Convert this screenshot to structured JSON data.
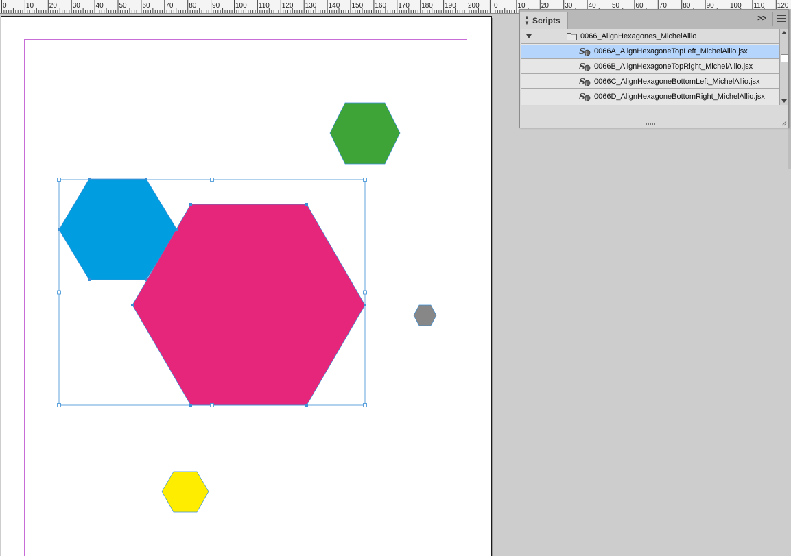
{
  "ruler": {
    "labels_left": [
      "0",
      "10",
      "20",
      "30",
      "40",
      "50",
      "60",
      "70",
      "80",
      "90",
      "100",
      "110",
      "120",
      "130",
      "140",
      "150",
      "160",
      "170",
      "180",
      "190",
      "200"
    ],
    "labels_right": [
      "0",
      "10",
      "20",
      "30",
      "40",
      "50",
      "60",
      "70",
      "80",
      "90",
      "100",
      "110",
      "120"
    ]
  },
  "colors": {
    "cyan_hexagon": "#009ee0",
    "magenta_hexagon": "#e5267b",
    "green_hexagon": "#3ea437",
    "gray_hexagon": "#878787",
    "yellow_hexagon": "#ffed00",
    "margin_guide": "#c86dd7",
    "selection": "#3a8fd6"
  },
  "scripts_panel": {
    "title": "Scripts",
    "collapse_label": ">>",
    "folder": {
      "name": "0066_AlignHexagones_MichelAllio",
      "expanded": true
    },
    "scripts": [
      {
        "name": "0066A_AlignHexagoneTopLeft_MichelAllio.jsx",
        "selected": true
      },
      {
        "name": "0066B_AlignHexagoneTopRight_MichelAllio.jsx",
        "selected": false
      },
      {
        "name": "0066C_AlignHexagoneBottomLeft_MichelAllio.jsx",
        "selected": false
      },
      {
        "name": "0066D_AlignHexagoneBottomRight_MichelAllio.jsx",
        "selected": false
      }
    ]
  }
}
